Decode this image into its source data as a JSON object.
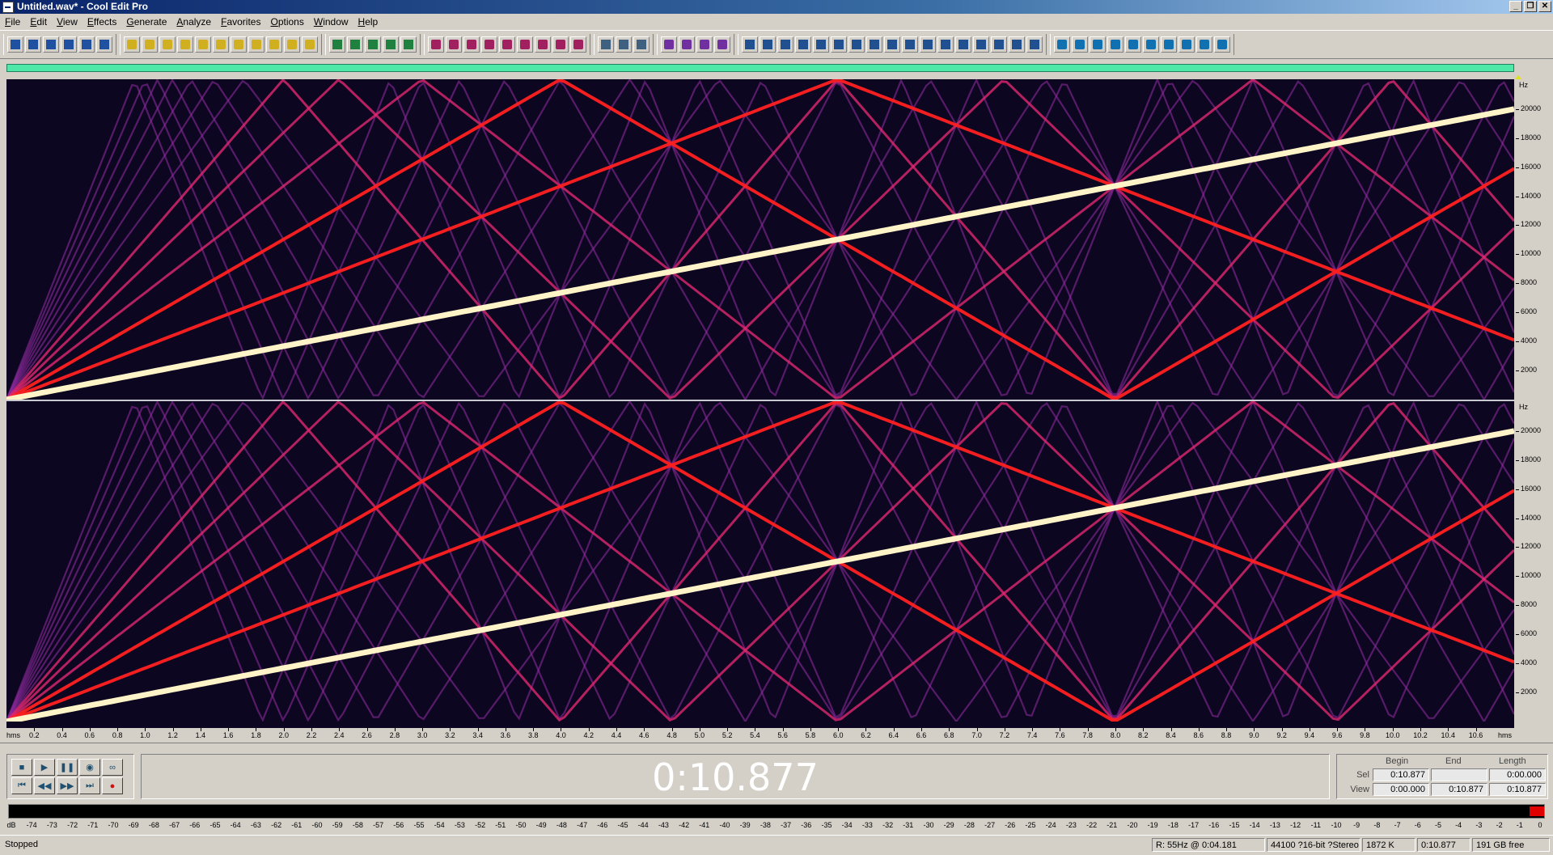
{
  "window": {
    "title": "Untitled.wav* - Cool Edit Pro",
    "minimize": "_",
    "restore": "❐",
    "close": "✕"
  },
  "menu": [
    "File",
    "Edit",
    "View",
    "Effects",
    "Generate",
    "Analyze",
    "Favorites",
    "Options",
    "Window",
    "Help"
  ],
  "toolbar_groups": [
    [
      "multitrack-view",
      "new-file",
      "open-file",
      "save-file",
      "save-all",
      "close-file"
    ],
    [
      "undo",
      "redo",
      "repeat-last",
      "copy",
      "cut",
      "paste",
      "paste-new",
      "mix-paste",
      "trim",
      "select-all",
      "snap"
    ],
    [
      "waveform-view",
      "spectral-view",
      "zoom-in-horiz",
      "zoom-out-horiz",
      "zoom-full"
    ],
    [
      "record",
      "play",
      "stop",
      "pause",
      "loop",
      "zoom-selection",
      "cue-list",
      "marker",
      "insert-cue"
    ],
    [
      "properties",
      "settings",
      "help"
    ],
    [
      "amplify",
      "dynamics",
      "envelope",
      "normalize"
    ],
    [
      "hard-limit",
      "noise-reduction",
      "click-eliminator",
      "hiss-reduction",
      "reverb",
      "echo",
      "chorus",
      "delay",
      "flanger",
      "filter",
      "graphic-eq",
      "parametric-eq",
      "pitch",
      "stretch",
      "brainwave",
      "distortion",
      "convolution"
    ],
    [
      "generate-tone",
      "generate-noise",
      "generate-dtmf",
      "generate-silence",
      "analyze-frequency",
      "analyze-phase",
      "statistics",
      "scan-clips",
      "batch",
      "script"
    ]
  ],
  "spectral": {
    "frequency_unit": "Hz",
    "frequency_ticks": [
      "20000",
      "18000",
      "16000",
      "14000",
      "12000",
      "10000",
      "8000",
      "6000",
      "4000",
      "2000"
    ],
    "time_unit": "hms",
    "time_ticks": [
      "0.2",
      "0.4",
      "0.6",
      "0.8",
      "1.0",
      "1.2",
      "1.4",
      "1.6",
      "1.8",
      "2.0",
      "2.2",
      "2.4",
      "2.6",
      "2.8",
      "3.0",
      "3.2",
      "3.4",
      "3.6",
      "3.8",
      "4.0",
      "4.2",
      "4.4",
      "4.6",
      "4.8",
      "5.0",
      "5.2",
      "5.4",
      "5.6",
      "5.8",
      "6.0",
      "6.2",
      "6.4",
      "6.6",
      "6.8",
      "7.0",
      "7.2",
      "7.4",
      "7.6",
      "7.8",
      "8.0",
      "8.2",
      "8.4",
      "8.6",
      "8.8",
      "9.0",
      "9.2",
      "9.4",
      "9.6",
      "9.8",
      "10.0",
      "10.2",
      "10.4",
      "10.6"
    ],
    "channels": [
      "left",
      "right"
    ],
    "colors": {
      "background": "#0c0620",
      "fundamental": "#fff4c8",
      "strong": "#ff2020",
      "medium": "#e02870",
      "weak": "#8c2a9c"
    }
  },
  "transport": {
    "buttons": [
      {
        "name": "stop-button",
        "icon": "■"
      },
      {
        "name": "play-button",
        "icon": "▶"
      },
      {
        "name": "pause-button",
        "icon": "❚❚"
      },
      {
        "name": "play-to-end-button",
        "icon": "◉"
      },
      {
        "name": "loop-button",
        "icon": "∞"
      },
      {
        "name": "go-to-start-button",
        "icon": "⏮"
      },
      {
        "name": "rewind-button",
        "icon": "◀◀"
      },
      {
        "name": "fast-forward-button",
        "icon": "▶▶"
      },
      {
        "name": "go-to-end-button",
        "icon": "⏭"
      },
      {
        "name": "record-button",
        "icon": "●"
      }
    ],
    "time": "0:10.877"
  },
  "selection": {
    "headers": {
      "begin": "Begin",
      "end": "End",
      "length": "Length"
    },
    "sel": {
      "label": "Sel",
      "begin": "0:10.877",
      "end": "",
      "length": "0:00.000"
    },
    "view": {
      "label": "View",
      "begin": "0:00.000",
      "end": "0:10.877",
      "length": "0:10.877"
    }
  },
  "level_meter": {
    "ticks": [
      "dB",
      "-74",
      "-73",
      "-72",
      "-71",
      "-70",
      "-69",
      "-68",
      "-67",
      "-66",
      "-65",
      "-64",
      "-63",
      "-62",
      "-61",
      "-60",
      "-59",
      "-58",
      "-57",
      "-56",
      "-55",
      "-54",
      "-53",
      "-52",
      "-51",
      "-50",
      "-49",
      "-48",
      "-47",
      "-46",
      "-45",
      "-44",
      "-43",
      "-42",
      "-41",
      "-40",
      "-39",
      "-38",
      "-37",
      "-36",
      "-35",
      "-34",
      "-33",
      "-32",
      "-31",
      "-30",
      "-29",
      "-28",
      "-27",
      "-26",
      "-25",
      "-24",
      "-23",
      "-22",
      "-21",
      "-20",
      "-19",
      "-18",
      "-17",
      "-16",
      "-15",
      "-14",
      "-13",
      "-12",
      "-11",
      "-10",
      "-9",
      "-8",
      "-7",
      "-6",
      "-5",
      "-4",
      "-3",
      "-2",
      "-1",
      "0"
    ]
  },
  "status": {
    "state": "Stopped",
    "cursor": "R: 55Hz @   0:04.181",
    "format": "44100 ?16-bit ?Stereo",
    "size": "1872 K",
    "duration": "0:10.877",
    "free": "191 GB free"
  }
}
